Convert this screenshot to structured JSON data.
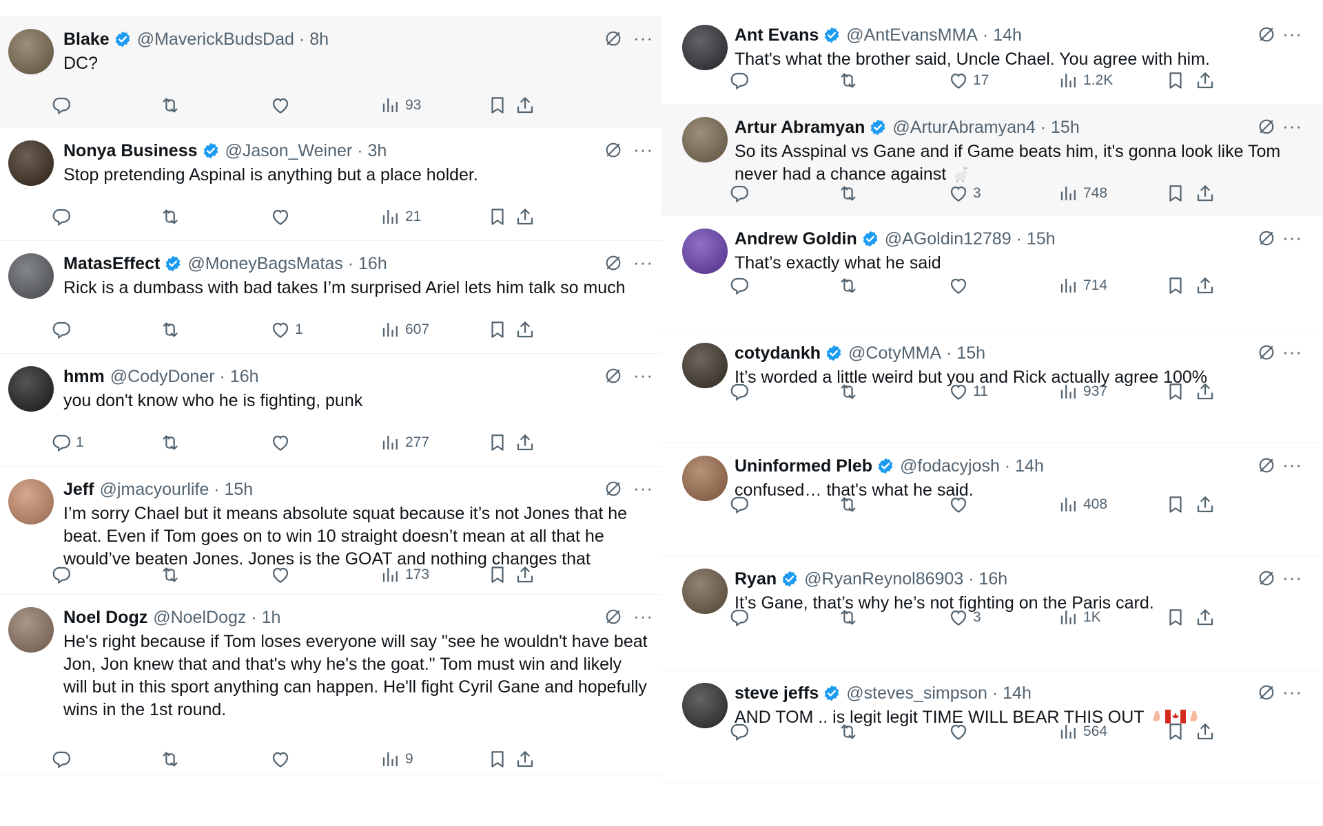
{
  "left_column": [
    {
      "name": "Blake",
      "verified": true,
      "handle": "@MaverickBudsDad",
      "time": "8h",
      "text": "DC?",
      "replies": "",
      "reposts": "",
      "likes": "",
      "views": "93",
      "avatar_color": "#7a6a4f"
    },
    {
      "name": "Nonya Business",
      "verified": true,
      "handle": "@Jason_Weiner",
      "time": "3h",
      "text": "Stop pretending Aspinal is anything but a place holder.",
      "replies": "",
      "reposts": "",
      "likes": "",
      "views": "21",
      "avatar_color": "#3a2a1a"
    },
    {
      "name": "MatasEffect",
      "verified": true,
      "handle": "@MoneyBagsMatas",
      "time": "16h",
      "text": "Rick is a dumbass with bad takes I’m surprised Ariel lets him talk so much",
      "replies": "",
      "reposts": "",
      "likes": "1",
      "views": "607",
      "avatar_color": "#5b5e63"
    },
    {
      "name": "hmm",
      "verified": false,
      "handle": "@CodyDoner",
      "time": "16h",
      "text": "you don't know who he is fighting, punk",
      "replies": "1",
      "reposts": "",
      "likes": "",
      "views": "277",
      "avatar_color": "#1c1c1c"
    },
    {
      "name": "Jeff",
      "verified": false,
      "handle": "@jmacyourlife",
      "time": "15h",
      "text": "I’m sorry Chael but it means absolute squat because it’s not Jones that he beat. Even if Tom goes on to win 10 straight doesn’t mean at all that he would’ve beaten Jones. Jones is the GOAT and nothing changes that",
      "replies": "",
      "reposts": "",
      "likes": "",
      "views": "173",
      "avatar_color": "#c98a6a"
    },
    {
      "name": "Noel Dogz",
      "verified": false,
      "handle": "@NoelDogz",
      "time": "1h",
      "text": "He's right because if Tom loses everyone will say \"see he wouldn't have beat Jon, Jon knew that and that's why he's the goat.\" Tom must win and likely will but in this sport anything can happen. He'll fight Cyril Gane and hopefully wins in the 1st round.",
      "replies": "",
      "reposts": "",
      "likes": "",
      "views": "9",
      "avatar_color": "#8d7462"
    }
  ],
  "right_column": [
    {
      "name": "Ant Evans",
      "verified": true,
      "handle": "@AntEvansMMA",
      "time": "14h",
      "text": "That's what the brother said, Uncle Chael. You agree with him.",
      "replies": "",
      "reposts": "",
      "likes": "17",
      "views": "1.2K",
      "avatar_color": "#2d2f33"
    },
    {
      "name": "Artur Abramyan",
      "verified": true,
      "handle": "@ArturAbramyan4",
      "time": "15h",
      "text": "So its Asspinal vs Gane and if Game beats him, it's gonna look like Tom never had a chance against",
      "emoji": "goat",
      "replies": "",
      "reposts": "",
      "likes": "3",
      "views": "748",
      "avatar_color": "#7b6b52"
    },
    {
      "name": "Andrew Goldin",
      "verified": true,
      "handle": "@AGoldin12789",
      "time": "15h",
      "text": "That’s exactly what he said",
      "replies": "",
      "reposts": "",
      "likes": "",
      "views": "714",
      "avatar_color": "#6a3fb4"
    },
    {
      "name": "cotydankh",
      "verified": true,
      "handle": "@CotyMMA",
      "time": "15h",
      "text": "It’s worded a little weird but you and Rick actually agree 100%",
      "replies": "",
      "reposts": "",
      "likes": "11",
      "views": "937",
      "avatar_color": "#3b3328"
    },
    {
      "name": "Uninformed Pleb",
      "verified": true,
      "handle": "@fodacyjosh",
      "time": "14h",
      "text": "confused… that's what he said.",
      "replies": "",
      "reposts": "",
      "likes": "",
      "views": "408",
      "avatar_color": "#a06c4c"
    },
    {
      "name": "Ryan",
      "verified": true,
      "handle": "@RyanReynol86903",
      "time": "16h",
      "text": "It’s Gane, that’s why he’s not fighting on the Paris card.",
      "replies": "",
      "reposts": "",
      "likes": "3",
      "views": "1K",
      "avatar_color": "#6b5a45"
    },
    {
      "name": "steve jeffs",
      "verified": true,
      "handle": "@steves_simpson",
      "time": "14h",
      "text": "AND TOM .. is legit legit TIME WILL BEAR THIS OUT",
      "emoji": "clap-canada-clap",
      "replies": "",
      "reposts": "",
      "likes": "",
      "views": "564",
      "avatar_color": "#2f2f2f"
    }
  ],
  "colors": {
    "text": "#0f1419",
    "secondary": "#536471",
    "verified": "#1d9bf0",
    "border": "#eff3f4",
    "shaded_bg": "#f7f7f7"
  }
}
